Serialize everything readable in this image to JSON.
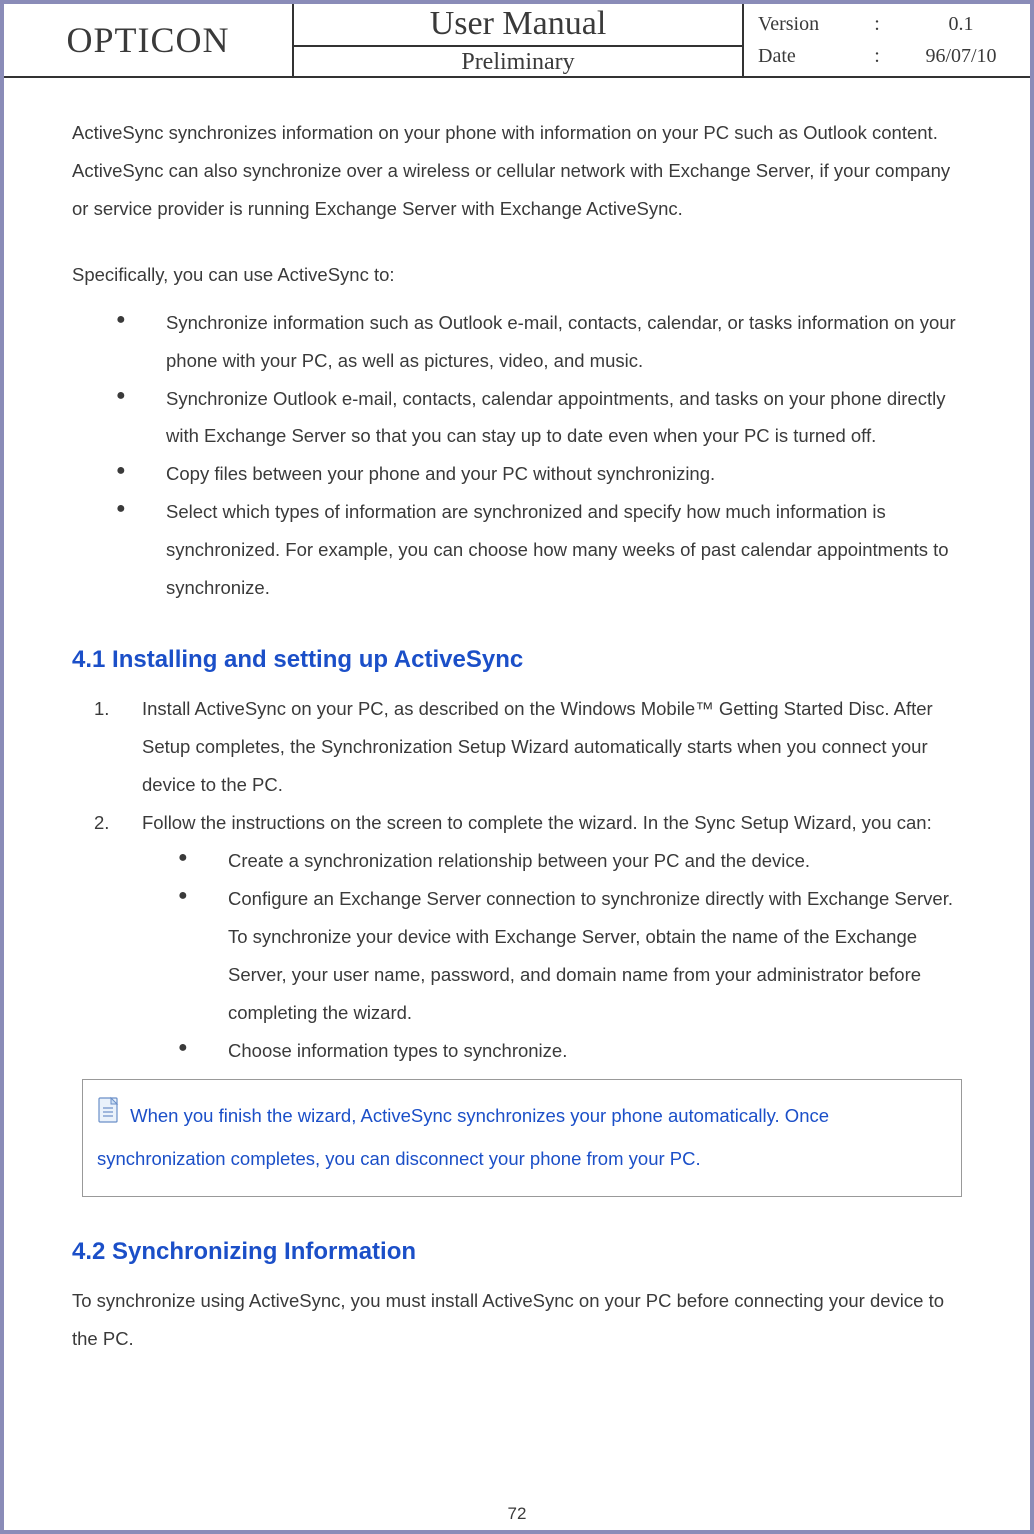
{
  "header": {
    "brand": "OPTICON",
    "title": "User Manual",
    "subtitle": "Preliminary",
    "version_label": "Version",
    "version_value": "0.1",
    "date_label": "Date",
    "date_value": "96/07/10"
  },
  "intro_paragraph": "ActiveSync synchronizes information on your phone with information on your PC such as Outlook content. ActiveSync can also synchronize over a wireless or cellular network with Exchange Server, if your company or service provider is running Exchange Server with Exchange ActiveSync.",
  "bullets_intro": "Specifically, you can use ActiveSync to:",
  "bullets": [
    "Synchronize information such as Outlook e-mail, contacts, calendar, or tasks information on your phone with your PC, as well as pictures, video, and music.",
    "Synchronize Outlook e-mail, contacts, calendar appointments, and tasks on your phone directly with Exchange Server so that you can stay up to date even when your PC is turned off.",
    "Copy files between your phone and your PC without synchronizing.",
    "Select which types of information are synchronized and specify how much information is synchronized. For example, you can choose how many weeks of past calendar appointments to synchronize."
  ],
  "section41": {
    "heading": "4.1 Installing and setting up ActiveSync",
    "steps": [
      {
        "num": "1.",
        "text": "Install ActiveSync on your PC, as described on the Windows Mobile™ Getting Started Disc. After Setup completes, the Synchronization Setup Wizard automatically starts when you connect your device to the PC."
      },
      {
        "num": "2.",
        "text": "Follow the instructions on the screen to complete the wizard. In the Sync Setup Wizard, you can:"
      }
    ],
    "substeps": [
      "Create a synchronization relationship between your PC and the device.",
      "Configure an Exchange Server connection to synchronize directly with Exchange Server. To synchronize your device with Exchange Server, obtain the name of the Exchange Server, your user name, password, and domain name from your administrator before completing the wizard.",
      "Choose information types to synchronize."
    ],
    "note": " When you finish the wizard, ActiveSync synchronizes your phone automatically. Once synchronization completes, you can disconnect your phone from your PC."
  },
  "section42": {
    "heading": "4.2 Synchronizing Information",
    "text": "To synchronize using ActiveSync, you must install ActiveSync on your PC before connecting your device to the PC."
  },
  "page_number": "72"
}
